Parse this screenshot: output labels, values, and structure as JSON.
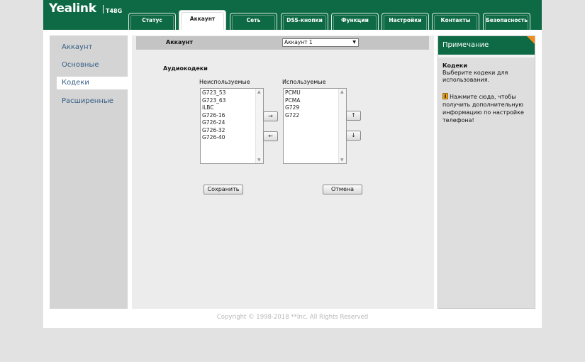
{
  "header": {
    "logo": "Yealink",
    "model": "T48G",
    "tabs": [
      {
        "label": "Статус",
        "active": false
      },
      {
        "label": "Аккаунт",
        "active": true
      },
      {
        "label": "Сеть",
        "active": false
      },
      {
        "label": "DSS-кнопки",
        "active": false
      },
      {
        "label": "Функции",
        "active": false
      },
      {
        "label": "Настройки",
        "active": false
      },
      {
        "label": "Контакты",
        "active": false
      },
      {
        "label": "Безопасность",
        "active": false
      }
    ]
  },
  "sidebar": {
    "items": [
      {
        "label": "Аккаунт",
        "active": false
      },
      {
        "label": "Основные",
        "active": false
      },
      {
        "label": "Кодеки",
        "active": true
      },
      {
        "label": "Расширенные",
        "active": false
      }
    ]
  },
  "main": {
    "account_label": "Аккаунт",
    "account_selected": "Аккаунт 1",
    "audio_codecs_title": "Аудиокодеки",
    "unused_label": "Неиспользуемые",
    "used_label": "Используемые",
    "unused_codecs": [
      "G723_53",
      "G723_63",
      "iLBC",
      "G726-16",
      "G726-24",
      "G726-32",
      "G726-40"
    ],
    "used_codecs": [
      "PCMU",
      "PCMA",
      "G729",
      "G722"
    ],
    "move_right_label": "→",
    "move_left_label": "←",
    "move_up_label": "↑",
    "move_down_label": "↓",
    "save_label": "Сохранить",
    "cancel_label": "Отмена"
  },
  "note": {
    "header": "Примечание",
    "title": "Кодеки",
    "text": "Выберите кодеки для использования.",
    "link": "Нажмите сюда, чтобы получить дополнительную информацию по настройке телефона!"
  },
  "footer": {
    "copyright": "Copyright © 1998-2018 **Inc. All Rights Reserved"
  },
  "colors": {
    "brand_green": "#0d6a45",
    "note_corner_orange": "#f28b1c",
    "sidebar_link_blue": "#345d84"
  }
}
